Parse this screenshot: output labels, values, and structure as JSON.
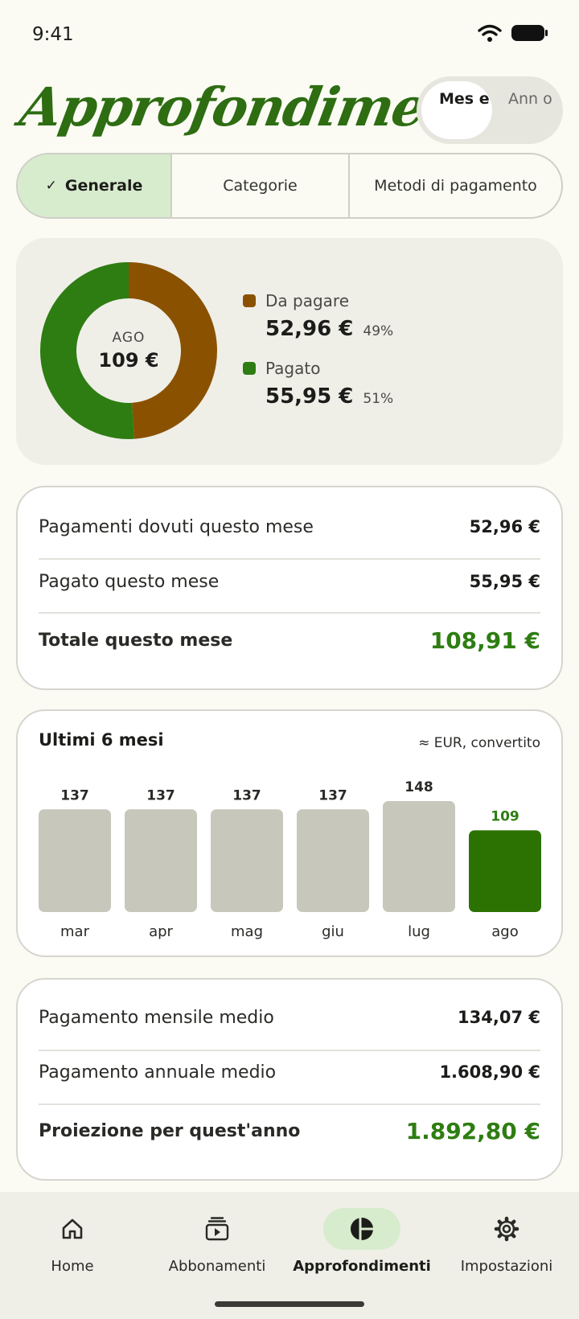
{
  "status": {
    "time": "9:41"
  },
  "header": {
    "title": "Approfondimenti",
    "period_toggle": {
      "selected": "Mese",
      "options": [
        "Mese",
        "Anno"
      ],
      "active_label": "Mes e",
      "inactive_label": "Ann o"
    }
  },
  "tabs": [
    {
      "label": "Generale",
      "selected": true
    },
    {
      "label": "Categorie",
      "selected": false
    },
    {
      "label": "Metodi di pagamento",
      "selected": false
    }
  ],
  "summary": {
    "center_month": "AGO",
    "center_total": "109 €",
    "items": [
      {
        "label": "Da pagare",
        "amount": "52,96 €",
        "percent": "49%",
        "share": 0.49,
        "color": "#8a5200"
      },
      {
        "label": "Pagato",
        "amount": "55,95 €",
        "percent": "51%",
        "share": 0.51,
        "color": "#2e7d12"
      }
    ]
  },
  "month_totals": {
    "rows": [
      {
        "label": "Pagamenti dovuti questo mese",
        "value": "52,96 €"
      },
      {
        "label": "Pagato questo mese",
        "value": "55,95 €"
      }
    ],
    "total": {
      "label": "Totale questo mese",
      "value": "108,91 €"
    }
  },
  "chart_data": {
    "type": "bar",
    "title": "Ultimi 6 mesi",
    "subtitle": "≈ EUR, convertito",
    "categories": [
      "mar",
      "apr",
      "mag",
      "giu",
      "lug",
      "ago"
    ],
    "values": [
      137,
      137,
      137,
      137,
      148,
      109
    ],
    "highlight_index": 5,
    "colors": {
      "bar": "#c7c8bb",
      "highlight": "#2b7203",
      "label": "#2a2a27",
      "highlight_label": "#2e7d12"
    }
  },
  "averages": {
    "rows": [
      {
        "label": "Pagamento mensile medio",
        "value": "134,07 €"
      },
      {
        "label": "Pagamento annuale medio",
        "value": "1.608,90 €"
      }
    ],
    "total": {
      "label": "Proiezione per quest'anno",
      "value": "1.892,80 €"
    }
  },
  "nav": [
    {
      "label": "Home",
      "icon": "home-icon",
      "selected": false
    },
    {
      "label": "Abbonamenti",
      "icon": "subscriptions-icon",
      "selected": false
    },
    {
      "label": "Approfondimenti",
      "icon": "insights-icon",
      "selected": true
    },
    {
      "label": "Impostazioni",
      "icon": "gear-icon",
      "selected": false
    }
  ]
}
